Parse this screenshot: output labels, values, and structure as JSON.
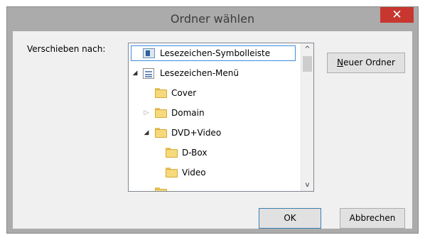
{
  "window": {
    "title": "Ordner wählen",
    "close_glyph": "✕"
  },
  "form": {
    "move_to_label": "Verschieben nach:"
  },
  "tree": {
    "items": [
      {
        "label": "Lesezeichen-Symbolleiste",
        "icon": "toolbar-icon",
        "level": 0,
        "expander": "",
        "selected": true
      },
      {
        "label": "Lesezeichen-Menü",
        "icon": "menu-icon",
        "level": 0,
        "expander": "expanded"
      },
      {
        "label": "Cover",
        "icon": "folder-icon",
        "level": 1,
        "expander": ""
      },
      {
        "label": "Domain",
        "icon": "folder-icon",
        "level": 1,
        "expander": "collapsed"
      },
      {
        "label": "DVD+Video",
        "icon": "folder-icon",
        "level": 1,
        "expander": "expanded"
      },
      {
        "label": "D-Box",
        "icon": "folder-icon",
        "level": 2,
        "expander": ""
      },
      {
        "label": "Video",
        "icon": "folder-icon",
        "level": 2,
        "expander": ""
      }
    ],
    "scroll_up_glyph": "^",
    "scroll_down_glyph": "v"
  },
  "buttons": {
    "new_folder_label_mnemonic": "N",
    "new_folder_label_rest": "euer Ordner",
    "ok_label": "OK",
    "cancel_label": "Abbrechen"
  },
  "glyphs": {
    "expanded": "◢",
    "collapsed": "▷"
  }
}
